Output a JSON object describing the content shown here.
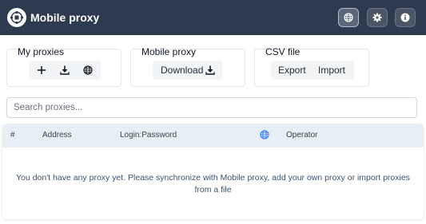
{
  "header": {
    "title": "Mobile proxy",
    "logo_icon": "network-logo-icon",
    "buttons": [
      {
        "name": "language-button",
        "icon": "globe-icon"
      },
      {
        "name": "settings-button",
        "icon": "gear-icon"
      },
      {
        "name": "info-button",
        "icon": "info-icon"
      }
    ]
  },
  "toolbar": {
    "my_proxies": {
      "title": "My proxies"
    },
    "mobile_proxy": {
      "title": "Mobile proxy",
      "download_label": "Download"
    },
    "csv_file": {
      "title": "CSV file",
      "export_label": "Export",
      "import_label": "Import"
    }
  },
  "search": {
    "placeholder": "Search proxies...",
    "value": ""
  },
  "table": {
    "columns": [
      "#",
      "Address",
      "Login:Password",
      "",
      "Operator"
    ],
    "empty_message": "You don't have any proxy yet. Please synchronize with Mobile proxy, add your own proxy or import proxies from a file"
  },
  "colors": {
    "header_bg": "#2d3a4f",
    "table_header_bg": "#e8eef6",
    "globe_accent": "#3b82f6",
    "empty_text": "#3b5470"
  }
}
